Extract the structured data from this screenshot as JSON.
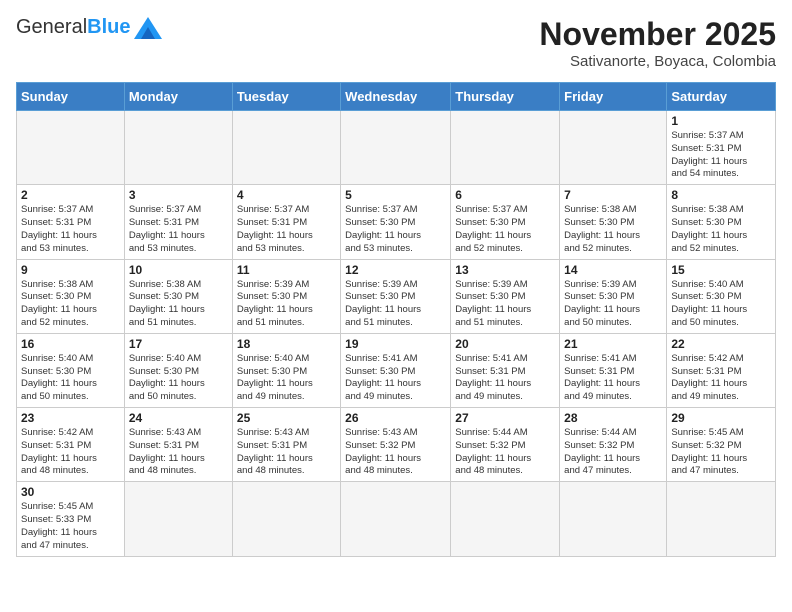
{
  "header": {
    "logo_general": "General",
    "logo_blue": "Blue",
    "month_year": "November 2025",
    "location": "Sativanorte, Boyaca, Colombia"
  },
  "days_of_week": [
    "Sunday",
    "Monday",
    "Tuesday",
    "Wednesday",
    "Thursday",
    "Friday",
    "Saturday"
  ],
  "weeks": [
    [
      {
        "day": "",
        "info": ""
      },
      {
        "day": "",
        "info": ""
      },
      {
        "day": "",
        "info": ""
      },
      {
        "day": "",
        "info": ""
      },
      {
        "day": "",
        "info": ""
      },
      {
        "day": "",
        "info": ""
      },
      {
        "day": "1",
        "info": "Sunrise: 5:37 AM\nSunset: 5:31 PM\nDaylight: 11 hours\nand 54 minutes."
      }
    ],
    [
      {
        "day": "2",
        "info": "Sunrise: 5:37 AM\nSunset: 5:31 PM\nDaylight: 11 hours\nand 53 minutes."
      },
      {
        "day": "3",
        "info": "Sunrise: 5:37 AM\nSunset: 5:31 PM\nDaylight: 11 hours\nand 53 minutes."
      },
      {
        "day": "4",
        "info": "Sunrise: 5:37 AM\nSunset: 5:31 PM\nDaylight: 11 hours\nand 53 minutes."
      },
      {
        "day": "5",
        "info": "Sunrise: 5:37 AM\nSunset: 5:30 PM\nDaylight: 11 hours\nand 53 minutes."
      },
      {
        "day": "6",
        "info": "Sunrise: 5:37 AM\nSunset: 5:30 PM\nDaylight: 11 hours\nand 52 minutes."
      },
      {
        "day": "7",
        "info": "Sunrise: 5:38 AM\nSunset: 5:30 PM\nDaylight: 11 hours\nand 52 minutes."
      },
      {
        "day": "8",
        "info": "Sunrise: 5:38 AM\nSunset: 5:30 PM\nDaylight: 11 hours\nand 52 minutes."
      }
    ],
    [
      {
        "day": "9",
        "info": "Sunrise: 5:38 AM\nSunset: 5:30 PM\nDaylight: 11 hours\nand 52 minutes."
      },
      {
        "day": "10",
        "info": "Sunrise: 5:38 AM\nSunset: 5:30 PM\nDaylight: 11 hours\nand 51 minutes."
      },
      {
        "day": "11",
        "info": "Sunrise: 5:39 AM\nSunset: 5:30 PM\nDaylight: 11 hours\nand 51 minutes."
      },
      {
        "day": "12",
        "info": "Sunrise: 5:39 AM\nSunset: 5:30 PM\nDaylight: 11 hours\nand 51 minutes."
      },
      {
        "day": "13",
        "info": "Sunrise: 5:39 AM\nSunset: 5:30 PM\nDaylight: 11 hours\nand 51 minutes."
      },
      {
        "day": "14",
        "info": "Sunrise: 5:39 AM\nSunset: 5:30 PM\nDaylight: 11 hours\nand 50 minutes."
      },
      {
        "day": "15",
        "info": "Sunrise: 5:40 AM\nSunset: 5:30 PM\nDaylight: 11 hours\nand 50 minutes."
      }
    ],
    [
      {
        "day": "16",
        "info": "Sunrise: 5:40 AM\nSunset: 5:30 PM\nDaylight: 11 hours\nand 50 minutes."
      },
      {
        "day": "17",
        "info": "Sunrise: 5:40 AM\nSunset: 5:30 PM\nDaylight: 11 hours\nand 50 minutes."
      },
      {
        "day": "18",
        "info": "Sunrise: 5:40 AM\nSunset: 5:30 PM\nDaylight: 11 hours\nand 49 minutes."
      },
      {
        "day": "19",
        "info": "Sunrise: 5:41 AM\nSunset: 5:30 PM\nDaylight: 11 hours\nand 49 minutes."
      },
      {
        "day": "20",
        "info": "Sunrise: 5:41 AM\nSunset: 5:31 PM\nDaylight: 11 hours\nand 49 minutes."
      },
      {
        "day": "21",
        "info": "Sunrise: 5:41 AM\nSunset: 5:31 PM\nDaylight: 11 hours\nand 49 minutes."
      },
      {
        "day": "22",
        "info": "Sunrise: 5:42 AM\nSunset: 5:31 PM\nDaylight: 11 hours\nand 49 minutes."
      }
    ],
    [
      {
        "day": "23",
        "info": "Sunrise: 5:42 AM\nSunset: 5:31 PM\nDaylight: 11 hours\nand 48 minutes."
      },
      {
        "day": "24",
        "info": "Sunrise: 5:43 AM\nSunset: 5:31 PM\nDaylight: 11 hours\nand 48 minutes."
      },
      {
        "day": "25",
        "info": "Sunrise: 5:43 AM\nSunset: 5:31 PM\nDaylight: 11 hours\nand 48 minutes."
      },
      {
        "day": "26",
        "info": "Sunrise: 5:43 AM\nSunset: 5:32 PM\nDaylight: 11 hours\nand 48 minutes."
      },
      {
        "day": "27",
        "info": "Sunrise: 5:44 AM\nSunset: 5:32 PM\nDaylight: 11 hours\nand 48 minutes."
      },
      {
        "day": "28",
        "info": "Sunrise: 5:44 AM\nSunset: 5:32 PM\nDaylight: 11 hours\nand 47 minutes."
      },
      {
        "day": "29",
        "info": "Sunrise: 5:45 AM\nSunset: 5:32 PM\nDaylight: 11 hours\nand 47 minutes."
      }
    ],
    [
      {
        "day": "30",
        "info": "Sunrise: 5:45 AM\nSunset: 5:33 PM\nDaylight: 11 hours\nand 47 minutes."
      },
      {
        "day": "",
        "info": ""
      },
      {
        "day": "",
        "info": ""
      },
      {
        "day": "",
        "info": ""
      },
      {
        "day": "",
        "info": ""
      },
      {
        "day": "",
        "info": ""
      },
      {
        "day": "",
        "info": ""
      }
    ]
  ]
}
